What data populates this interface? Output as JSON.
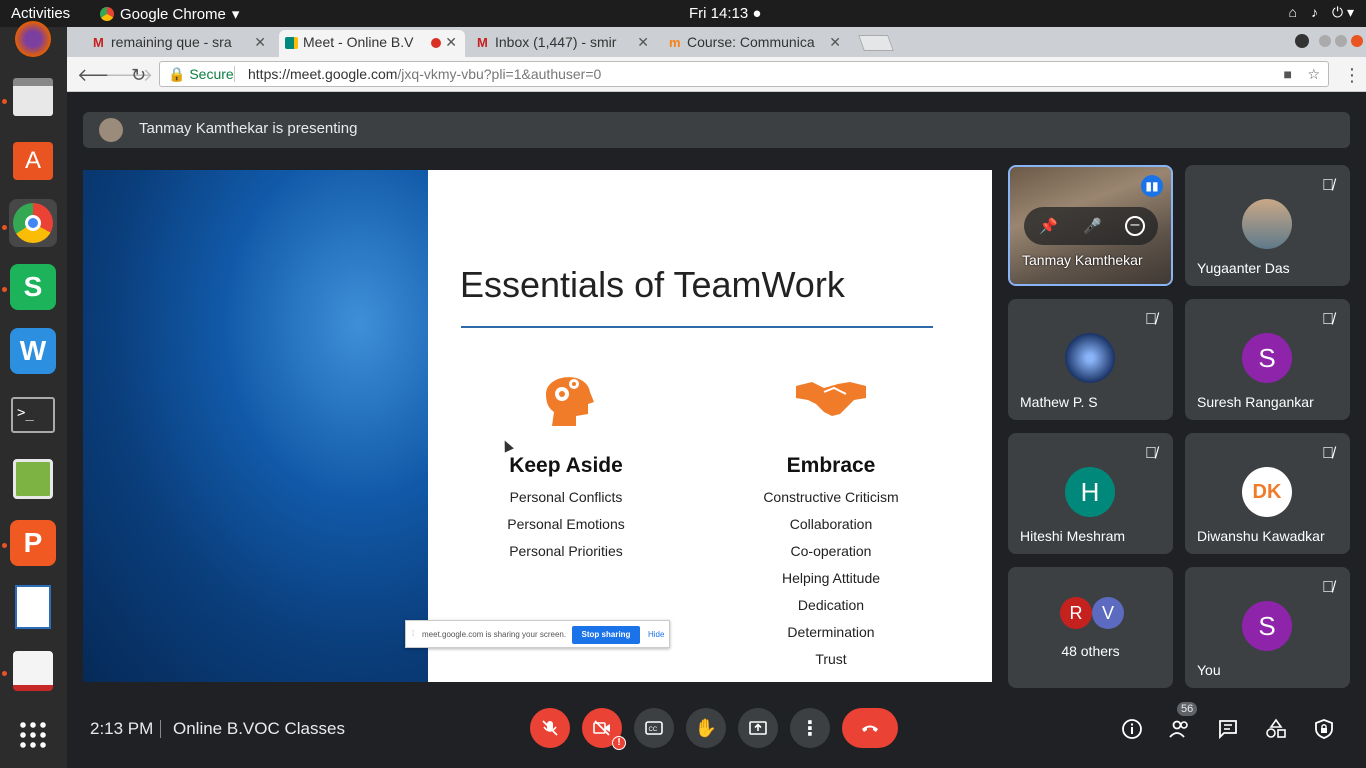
{
  "system": {
    "activities": "Activities",
    "app_name": "Google Chrome",
    "clock": "Fri 14:13 ●"
  },
  "browser": {
    "tabs": [
      {
        "label": "remaining que - sra",
        "icon": "gmail-icon"
      },
      {
        "label": "Meet - Online B.V",
        "icon": "meet-icon",
        "active": true
      },
      {
        "label": "Inbox (1,447) - smir",
        "icon": "gmail-icon"
      },
      {
        "label": "Course: Communica",
        "icon": "moodle-icon"
      }
    ],
    "secure_label": "Secure",
    "url_host": "https://meet.google.com",
    "url_path": "/jxq-vkmy-vbu?pli=1&authuser=0"
  },
  "meet": {
    "presenting_text": "Tanmay Kamthekar is presenting",
    "slide": {
      "title": "Essentials of TeamWork",
      "left_heading": "Keep Aside",
      "left_items": [
        "Personal Conflicts",
        "Personal Emotions",
        "Personal Priorities"
      ],
      "right_heading": "Embrace",
      "right_items": [
        "Constructive Criticism",
        "Collaboration",
        "Co-operation",
        "Helping Attitude",
        "Dedication",
        "Determination",
        "Trust"
      ]
    },
    "share_popup": {
      "text": "meet.google.com is sharing your screen.",
      "stop_label": "Stop sharing",
      "hide_label": "Hide"
    },
    "participants": [
      {
        "name": "Tanmay Kamthekar"
      },
      {
        "name": "Yugaanter Das"
      },
      {
        "name": "Mathew P. S"
      },
      {
        "name": "Suresh Rangankar",
        "initial": "S",
        "color": "#8e24aa"
      },
      {
        "name": "Hiteshi Meshram",
        "initial": "H",
        "color": "#00897b"
      },
      {
        "name": "Diwanshu Kawadkar"
      },
      {
        "name": "48 others",
        "initials": [
          "R",
          "V"
        ],
        "colors": [
          "#c5221f",
          "#5c6bc0"
        ]
      },
      {
        "name": "You",
        "initial": "S",
        "color": "#8e24aa"
      }
    ],
    "bottom": {
      "time": "2:13 PM",
      "meeting_name": "Online B.VOC Classes",
      "participant_count": "56"
    }
  }
}
